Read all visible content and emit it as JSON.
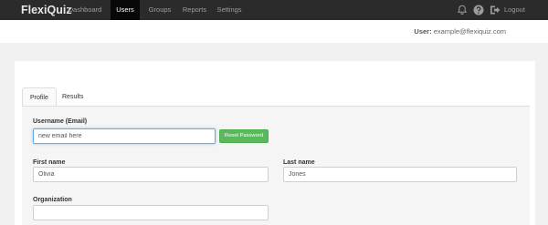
{
  "app": {
    "logo_text": "FlexiQuiz"
  },
  "nav": {
    "items": [
      {
        "label": "Dashboard"
      },
      {
        "label": "Users"
      },
      {
        "label": "Groups"
      },
      {
        "label": "Reports"
      },
      {
        "label": "Settings"
      }
    ],
    "active": "Users",
    "icons": [
      "bell-icon",
      "help-icon",
      "logout-icon"
    ],
    "logout_label": "Logout"
  },
  "userbar": {
    "prefix": "User:",
    "email": "example@flexiquiz.com"
  },
  "tabs": [
    {
      "label": "Profile"
    },
    {
      "label": "Results"
    }
  ],
  "form": {
    "username": {
      "label": "Username (Email)",
      "value": "new email here"
    },
    "reset_button": "Reset Password",
    "first_name": {
      "label": "First name",
      "value": "Olivia"
    },
    "last_name": {
      "label": "Last name",
      "value": "Jones"
    },
    "organization": {
      "label": "Organization",
      "value": ""
    }
  },
  "colors": {
    "navbar": "#2b2b2b",
    "accent_green": "#5cb85c",
    "focus_blue": "#66afe9"
  }
}
